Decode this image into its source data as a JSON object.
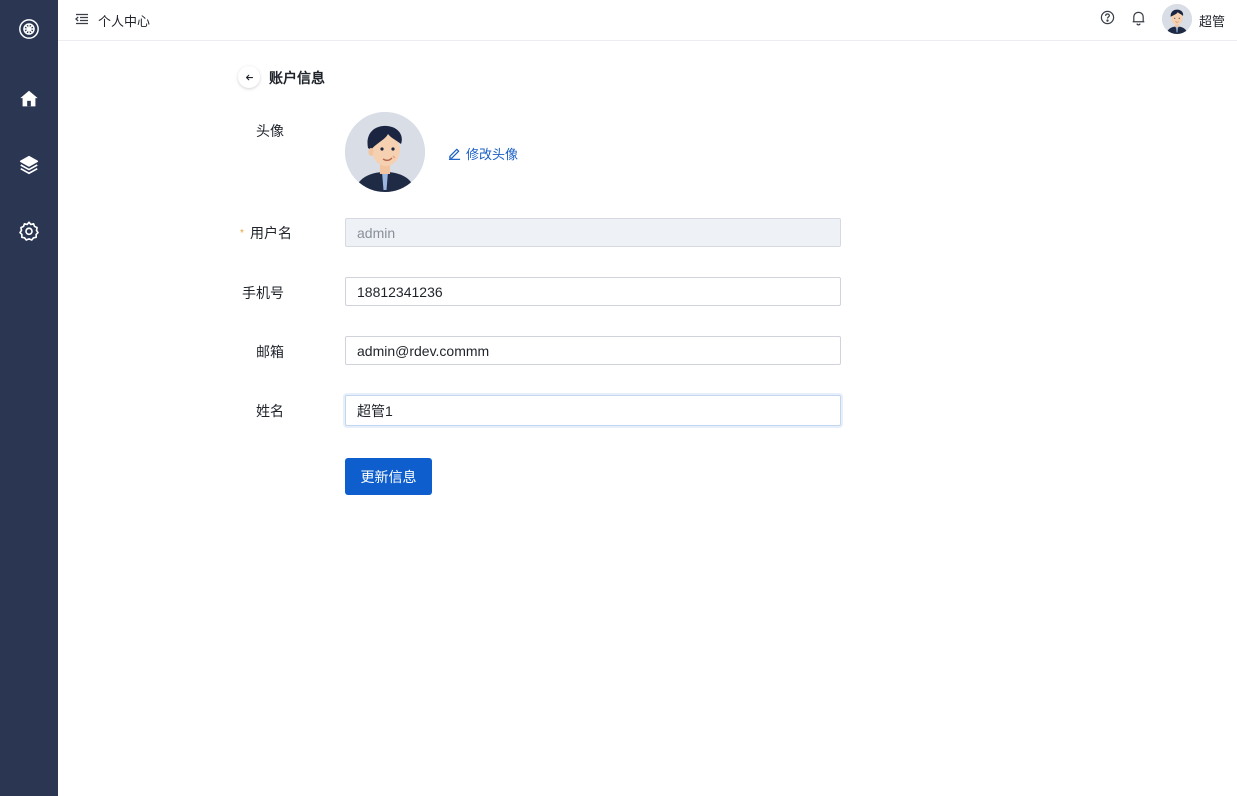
{
  "header": {
    "page_name": "个人中心",
    "user_name": "超管"
  },
  "sidebar": {
    "items": [
      {
        "icon": "logo-icon"
      },
      {
        "icon": "home-icon"
      },
      {
        "icon": "layers-icon"
      },
      {
        "icon": "settings-icon"
      }
    ]
  },
  "profile": {
    "title": "账户信息",
    "avatar_label": "头像",
    "edit_avatar_label": "修改头像",
    "username_label": "用户名",
    "username_value": "admin",
    "phone_label": "手机号",
    "phone_value": "18812341236",
    "email_label": "邮箱",
    "email_value": "admin@rdev.commm",
    "name_label": "姓名",
    "name_value": "超管1",
    "submit_label": "更新信息"
  },
  "colors": {
    "sidebar": "#2b3752",
    "primary": "#0e5fcd",
    "link": "#1a5fc4",
    "required": "#e8a33d"
  }
}
